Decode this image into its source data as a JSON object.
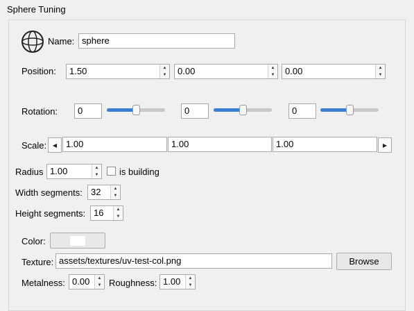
{
  "panel": {
    "title": "Sphere Tuning"
  },
  "name": {
    "label": "Name:",
    "value": "sphere"
  },
  "position": {
    "label": "Position:",
    "x": "1.50",
    "y": "0.00",
    "z": "0.00"
  },
  "rotation": {
    "label": "Rotation:",
    "x": "0",
    "y": "0",
    "z": "0",
    "x_level": 0.5,
    "y_level": 0.5,
    "z_level": 0.5
  },
  "scale": {
    "label": "Scale:",
    "x": "1.00",
    "y": "1.00",
    "z": "1.00"
  },
  "radius": {
    "label": "Radius",
    "value": "1.00"
  },
  "is_building": {
    "label": "is building",
    "checked": false
  },
  "width_segments": {
    "label": "Width segments:",
    "value": "32"
  },
  "height_segments": {
    "label": "Height segments:",
    "value": "16"
  },
  "color": {
    "label": "Color:",
    "swatch": "#ffffff"
  },
  "texture": {
    "label": "Texture:",
    "value": "assets/textures/uv-test-col.png",
    "browse_label": "Browse"
  },
  "metalness": {
    "label": "Metalness:",
    "value": "0.00"
  },
  "roughness": {
    "label": "Roughness:",
    "value": "1.00"
  },
  "icons": {
    "sphere": "sphere-icon",
    "up": "up-arrow",
    "down": "down-arrow",
    "left": "left-arrow",
    "right": "right-arrow"
  },
  "colors": {
    "slider_fill": "#3b7fd6",
    "slider_track": "#c8c8c8"
  }
}
